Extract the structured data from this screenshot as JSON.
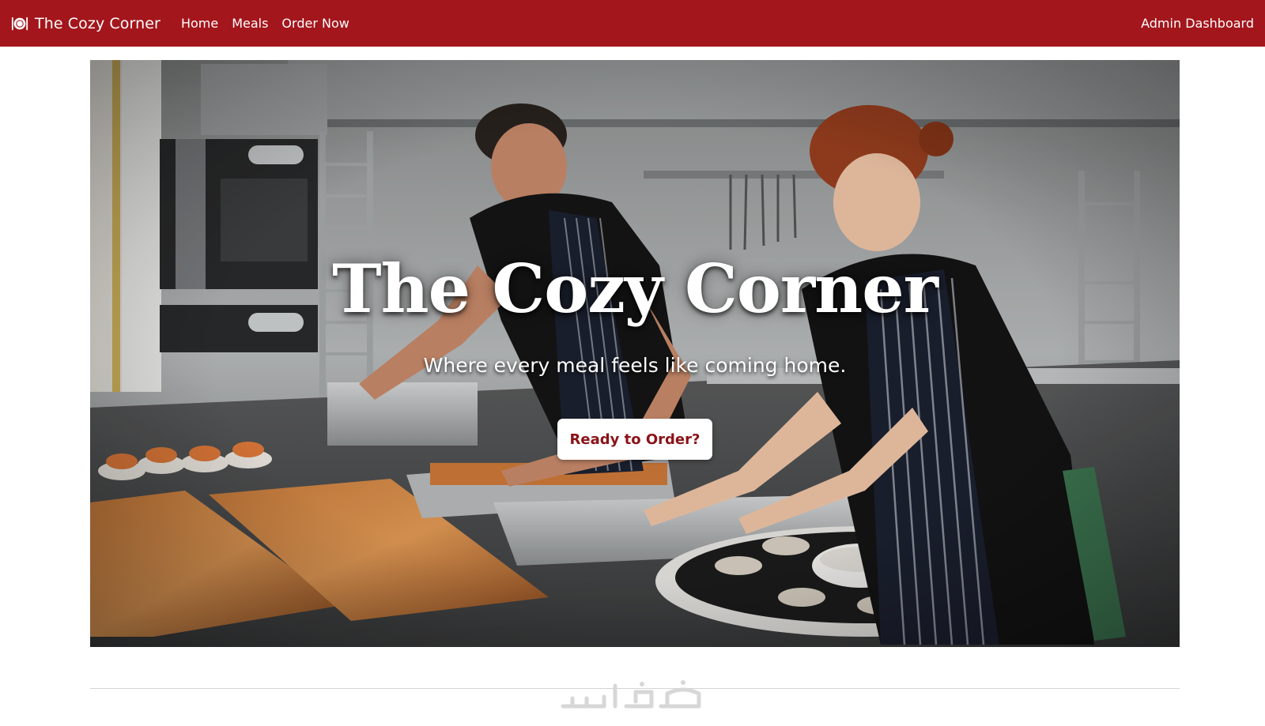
{
  "navbar": {
    "brand_icon": "plate-cutlery-icon",
    "brand": "The Cozy Corner",
    "links": [
      {
        "label": "Home"
      },
      {
        "label": "Meals"
      },
      {
        "label": "Order Now"
      }
    ],
    "right_link": "Admin Dashboard",
    "background_color": "#a3161c"
  },
  "hero": {
    "image": "restaurant-kitchen-chefs-photo",
    "title": "The Cozy Corner",
    "subtitle": "Where every meal feels like coming home.",
    "cta_label": "Ready to Order?",
    "cta_color": "#8b1218"
  },
  "footer": {
    "watermark": "خمسات"
  }
}
